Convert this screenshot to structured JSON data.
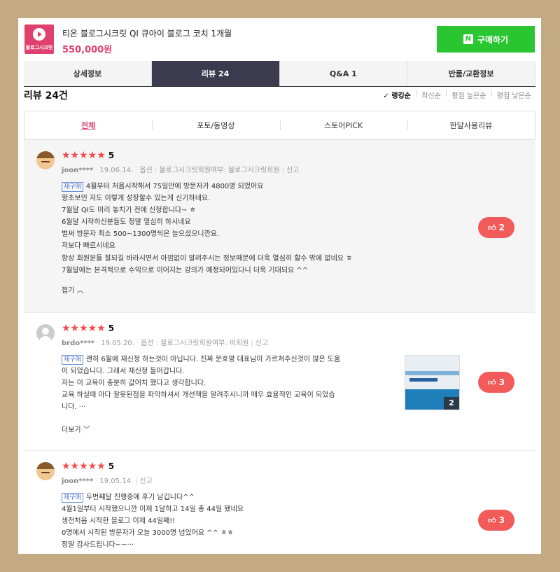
{
  "product": {
    "logo_text": "블로그시크릿",
    "title": "티온 블로그시크릿 QI 큐아이 블로그 코치 1개월",
    "price": "550,000원",
    "buy_badge": "N",
    "buy_label": "구매하기"
  },
  "tabs": [
    "상세정보",
    "리뷰 24",
    "Q&A 1",
    "반품/교환정보"
  ],
  "reviews_header": {
    "count": "리뷰 24건",
    "sort_options": [
      "✓ 랭킹순",
      "최신순",
      "평점 높은순",
      "평점 낮은순"
    ]
  },
  "filters": [
    "전체",
    "포토/동영상",
    "스토어PICK",
    "한달사용리뷰"
  ],
  "reviews": [
    {
      "stars": "★★★★★",
      "score": "5",
      "user": "joon****",
      "date": "19.06.14.",
      "option": "옵션 : 블로그시크릿회원여부: 블로그시크릿회원",
      "report": "신고",
      "rebuy": "재구매",
      "lines": [
        "4월부터 처음시작해서 75일만에 방문자가 4800명 되었어요",
        "왕초보인 저도 이렇게 성장할수 있는게 신기하네요.",
        "7월달 QI도 미리 놓치기 전에 신청합니다~ ㅎ",
        "6월달 시작하신분들도 정말 열심히 하시네요",
        "벌써 방문자 최소 500~1300명씩은 늘으셨으니깐요.",
        "저보다 빠르시네요",
        "항상 회원분들 잘되길 바라시면서 아낌없이 알려주시는 정보때문에 더욱 열심히 할수 밖에 없네요 ㅎ",
        "7월달에는 본격적으로 수익으로 이어지는 강의가 예정되어있다니 더욱 기대되요 ^^"
      ],
      "toggle": "접기 ︿",
      "likes": "2"
    },
    {
      "stars": "★★★★★",
      "score": "5",
      "user": "brdo****",
      "date": "19.05.20.",
      "option": "옵션 : 블로그시크릿회원여부: 비회원",
      "report": "신고",
      "rebuy": "재구매",
      "lines": [
        "괜히 6월에 재신청 하는것이 아닙니다. 진짜 문호영 대표님이 가르쳐주신것이 많은 도움",
        "이 되었습니다. 그래서 재신청 들어갑니다.",
        "저는 이 교육이 충분히 값어치 했다고 생각합니다.",
        "교육 하실때 마다 잘못된점을 파악하셔서 개선책을 알려주시니까 매우 효율적인 교육이 되었습",
        "니다. ···"
      ],
      "photo_count": "2",
      "toggle": "더보기 ﹀",
      "likes": "3"
    },
    {
      "stars": "★★★★★",
      "score": "5",
      "user": "joon****",
      "date": "19.05.14.",
      "report": "신고",
      "rebuy": "재구매",
      "lines": [
        "두번째달 진행중에 후기 남깁니다^^",
        "4월1일부터 시작했으니깐 이제 1달하고 14일 총 44일 됐네요",
        "생전처음 시작한 블로그 이제 44일째!!",
        "0명에서 시작된 방문자가 오늘 3000명 넘었어요 ^^ ㅎㅎ",
        "정말 감사드립니다~~···"
      ],
      "likes": "3"
    }
  ]
}
